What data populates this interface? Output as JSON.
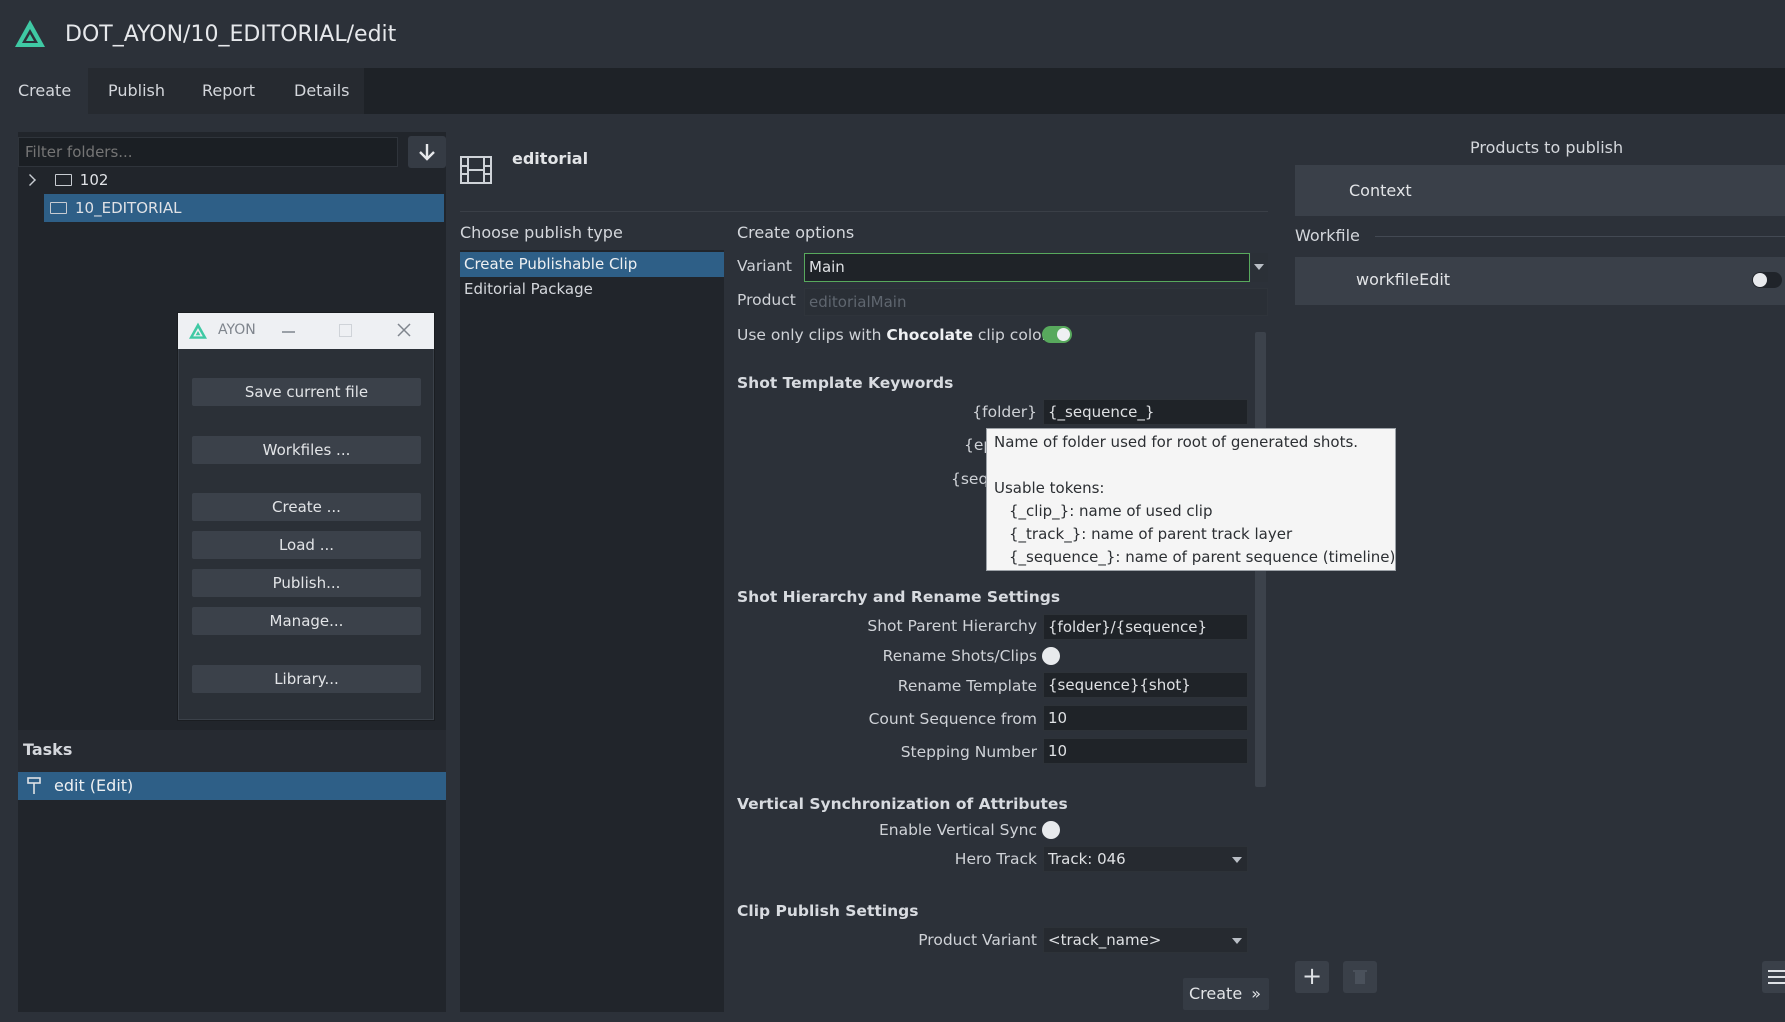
{
  "window": {
    "title": "DOT_AYON/10_EDITORIAL/edit"
  },
  "tabs": [
    "Create",
    "Publish",
    "Report",
    "Details"
  ],
  "folders": {
    "filter_placeholder": "Filter folders...",
    "items": [
      {
        "label": "102",
        "expanded": false
      },
      {
        "label": "10_EDITORIAL",
        "selected": true
      }
    ]
  },
  "tasks": {
    "heading": "Tasks",
    "items": [
      {
        "label": "edit (Edit)",
        "selected": true
      }
    ]
  },
  "ayon_dialog": {
    "title": "AYON",
    "buttons": [
      "Save current file",
      "Workfiles ...",
      "Create ...",
      "Load ...",
      "Publish...",
      "Manage...",
      "Library..."
    ]
  },
  "creator": {
    "name": "editorial",
    "publish_type_heading": "Choose publish type",
    "publish_types": [
      "Create Publishable Clip",
      "Editorial Package"
    ],
    "selected_type": "Create Publishable Clip",
    "create_options_heading": "Create options",
    "variant_label": "Variant",
    "variant_value": "Main",
    "product_label": "Product",
    "product_value": "editorialMain",
    "chocolate": {
      "pre": "Use only clips with ",
      "bold": "Chocolate",
      "post": " clip color",
      "enabled": true
    },
    "shot_template": {
      "heading": "Shot Template Keywords",
      "folder_label": "{folder}",
      "folder_value": "{_sequence_}",
      "ep_label_partial": "{ep",
      "seq_label_partial": "{seq"
    },
    "hierarchy": {
      "heading": "Shot Hierarchy and Rename Settings",
      "parent_hierarchy_label": "Shot Parent Hierarchy",
      "parent_hierarchy_value": "{folder}/{sequence}",
      "rename_label": "Rename Shots/Clips",
      "rename_enabled": false,
      "rename_template_label": "Rename Template",
      "rename_template_value": "{sequence}{shot}",
      "count_from_label": "Count Sequence from",
      "count_from_value": "10",
      "stepping_label": "Stepping Number",
      "stepping_value": "10"
    },
    "vertical_sync": {
      "heading": "Vertical Synchronization of Attributes",
      "enable_label": "Enable Vertical Sync",
      "enabled": false,
      "hero_track_label": "Hero Track",
      "hero_track_value": "Track: 046"
    },
    "clip_publish": {
      "heading": "Clip Publish Settings",
      "product_variant_label": "Product Variant",
      "product_variant_value": "<track_name>"
    },
    "create_button": "Create",
    "tooltip": {
      "line1": "Name of folder used for root of generated shots.",
      "line2": "Usable tokens:",
      "line3": "{_clip_}: name of used clip",
      "line4": "{_track_}: name of parent track layer",
      "line5": "{_sequence_}: name of parent sequence (timeline)"
    }
  },
  "products": {
    "heading": "Products to publish",
    "context_label": "Context",
    "workfile_heading": "Workfile",
    "workfile_item": "workfileEdit",
    "workfile_enabled": false
  },
  "colors": {
    "accent": "#2e5f87",
    "toggle_on": "#58a95d",
    "background": "#2c3139",
    "panel": "#21252b"
  }
}
